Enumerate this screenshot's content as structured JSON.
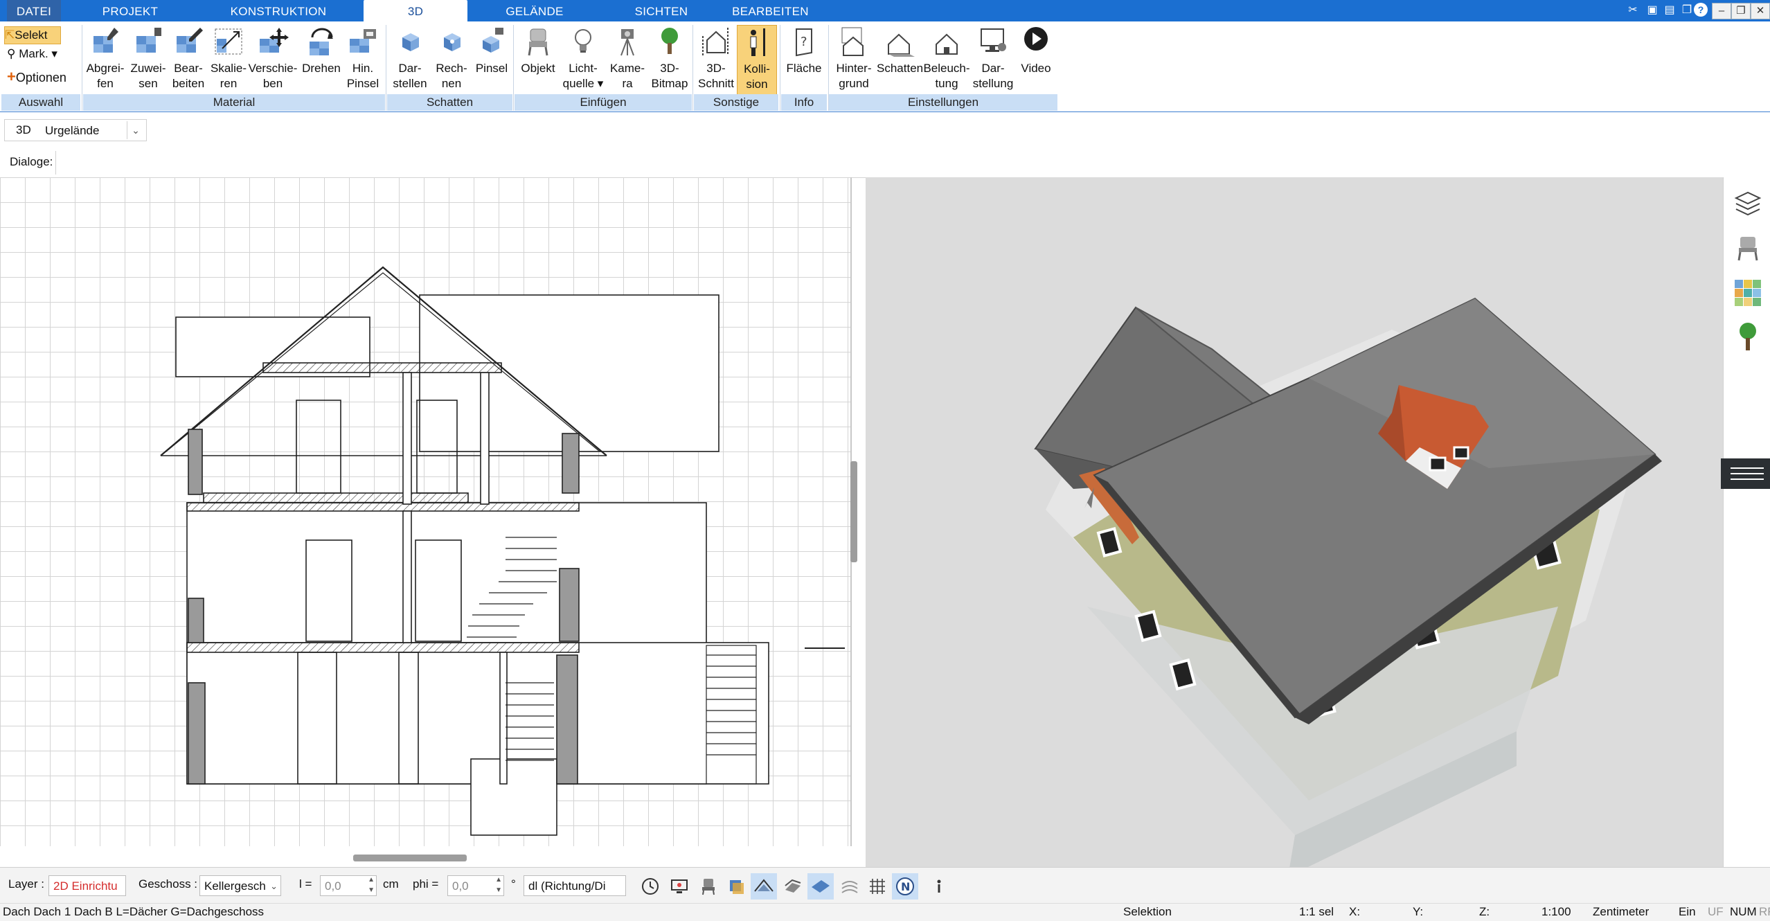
{
  "menu": {
    "tabs": [
      {
        "label": "DATEI"
      },
      {
        "label": "PROJEKT"
      },
      {
        "label": "KONSTRUKTION"
      },
      {
        "label": "3D"
      },
      {
        "label": "GELÄNDE"
      },
      {
        "label": "SICHTEN"
      },
      {
        "label": "BEARBEITEN"
      }
    ],
    "active_tab": "3D"
  },
  "ribbon": {
    "selection": {
      "select": "Selekt",
      "mark": "Mark.",
      "options": "Optionen",
      "group": "Auswahl"
    },
    "material": {
      "group": "Material",
      "buttons": [
        {
          "l1": "Abgrei-",
          "l2": "fen"
        },
        {
          "l1": "Zuwei-",
          "l2": "sen"
        },
        {
          "l1": "Bear-",
          "l2": "beiten"
        },
        {
          "l1": "Skalie-",
          "l2": "ren"
        },
        {
          "l1": "Verschie-",
          "l2": "ben"
        },
        {
          "l1": "Drehen",
          "l2": ""
        },
        {
          "l1": "Hin.",
          "l2": "Pinsel"
        }
      ]
    },
    "schatten": {
      "group": "Schatten",
      "buttons": [
        {
          "l1": "Dar-",
          "l2": "stellen"
        },
        {
          "l1": "Rech-",
          "l2": "nen"
        },
        {
          "l1": "Pinsel",
          "l2": ""
        }
      ]
    },
    "einfuegen": {
      "group": "Einfügen",
      "buttons": [
        {
          "l1": "Objekt",
          "l2": ""
        },
        {
          "l1": "Licht-",
          "l2": "quelle"
        },
        {
          "l1": "Kame-",
          "l2": "ra"
        },
        {
          "l1": "3D-",
          "l2": "Bitmap"
        }
      ]
    },
    "sonstige": {
      "group": "Sonstige",
      "buttons": [
        {
          "l1": "3D-",
          "l2": "Schnitt"
        },
        {
          "l1": "Kolli-",
          "l2": "sion"
        }
      ]
    },
    "info": {
      "group": "Info",
      "buttons": [
        {
          "l1": "Fläche",
          "l2": ""
        }
      ]
    },
    "einstellungen": {
      "group": "Einstellungen",
      "buttons": [
        {
          "l1": "Hinter-",
          "l2": "grund"
        },
        {
          "l1": "Schatten",
          "l2": ""
        },
        {
          "l1": "Beleuch-",
          "l2": "tung"
        },
        {
          "l1": "Dar-",
          "l2": "stellung"
        },
        {
          "l1": "Video",
          "l2": ""
        }
      ]
    }
  },
  "viewbar": {
    "mode": "3D",
    "terrain": "Urgelände"
  },
  "dialogbar": {
    "label": "Dialoge:"
  },
  "bottom": {
    "layer_label": "Layer :",
    "layer_value": "2D Einrichtu",
    "floor_label": "Geschoss :",
    "floor_value": "Kellergesch",
    "l_label": "l =",
    "l_value": "0,0",
    "l_unit": "cm",
    "phi_label": "phi =",
    "phi_value": "0,0",
    "phi_unit": "°",
    "direction_value": "dl (Richtung/Di"
  },
  "status": {
    "info": "Dach Dach 1 Dach B L=Dächer G=Dachgeschoss",
    "mode": "Selektion",
    "scale_sel": "1:1 sel",
    "x": "X:",
    "y": "Y:",
    "z": "Z:",
    "scale": "1:100",
    "unit": "Zentimeter",
    "ein": "Ein",
    "uf": "UF",
    "num": "NUM",
    "rf": "RF"
  },
  "colors": {
    "menubar": "#1b6fd1",
    "ribbon_group": "#c9def5",
    "active_button": "#f8d27a",
    "wall_fill": "#9a9a9a",
    "roof": "#6e6e6e",
    "dormer": "#c85a32",
    "facade": "#b8b98a"
  }
}
